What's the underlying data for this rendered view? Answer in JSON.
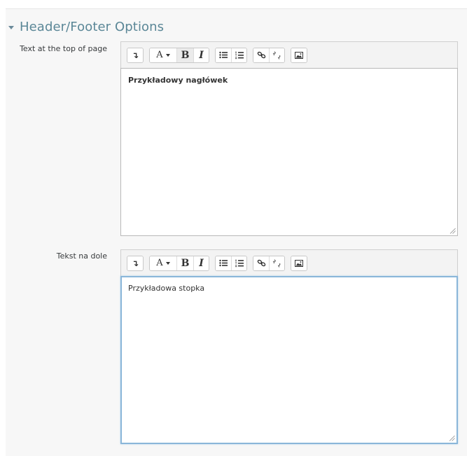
{
  "section": {
    "title": "Header/Footer Options"
  },
  "fields": [
    {
      "label": "Text at the top of page",
      "content": "Przykładowy nagłówek",
      "content_bold": true,
      "focused": false
    },
    {
      "label": "Tekst na dole",
      "content": "Przykładowa stopka",
      "content_bold": false,
      "focused": true
    }
  ],
  "toolbar": {
    "collapse_glyph": "↴",
    "font_glyph": "A",
    "bold_glyph": "B",
    "italic_glyph": "I",
    "icons": [
      "collapse-icon",
      "font-color-icon",
      "bold-icon",
      "italic-icon",
      "unordered-list-icon",
      "ordered-list-icon",
      "link-icon",
      "unlink-icon",
      "image-icon"
    ]
  },
  "colors": {
    "section_title": "#5b8797",
    "focus_border": "#8ab6d9",
    "panel_bg": "#f7f7f7"
  }
}
